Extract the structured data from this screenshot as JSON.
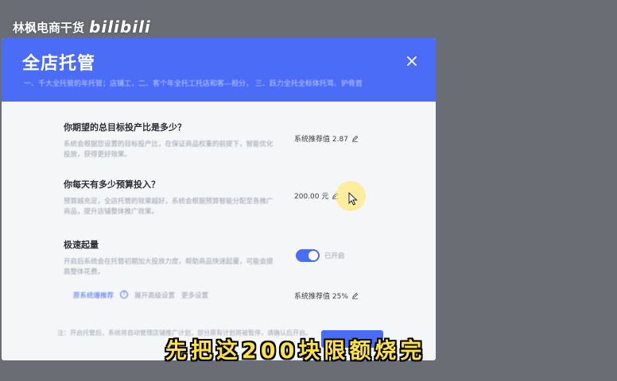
{
  "watermark": {
    "text": "林枫电商干货",
    "platform": "bilibili"
  },
  "modal": {
    "title": "全店托管",
    "description": "一、千大全托管的年托管；店铺工，二、客个年全托工托店和客—担分，    三、跃力全托全标体托骂、护骨首",
    "close_icon": "close-icon"
  },
  "questions": [
    {
      "title": "你期望的总目标投产比是多少？",
      "desc": "系统会根据您设置的目标投产比，在保证商品权重的前提下，智能优化投放，获得更好效果。",
      "value": "系统推荐值 2.87"
    },
    {
      "title": "你每天有多少预算投入？",
      "desc": "预算越充足，全店托管的效果越好，系统会根据预算智能分配至各推广商品，提升店铺整体推广效果。",
      "value": "200.00 元"
    },
    {
      "title": "极速起量",
      "desc": "开启后系统会在托管初期加大投放力度，帮助商品快速起量，可能会提高整体花费。",
      "toggle_label": "已开启",
      "toggle_on": true,
      "value": "系统推荐值 25%"
    }
  ],
  "links": {
    "primary": "原系统爆推荐",
    "secondary": "展开高级设置",
    "tertiary": "更多设置"
  },
  "footer": {
    "note": "注：开启托管后，系统将自动管理店铺推广计划，部分原有计划将被暂停，请确认后开启。",
    "confirm_label": ""
  },
  "subtitle": "先把这200块限额烧完",
  "colors": {
    "primary": "#4a6cf7",
    "subtitle": "#ffe14a",
    "backdrop": "#6b6d74"
  }
}
